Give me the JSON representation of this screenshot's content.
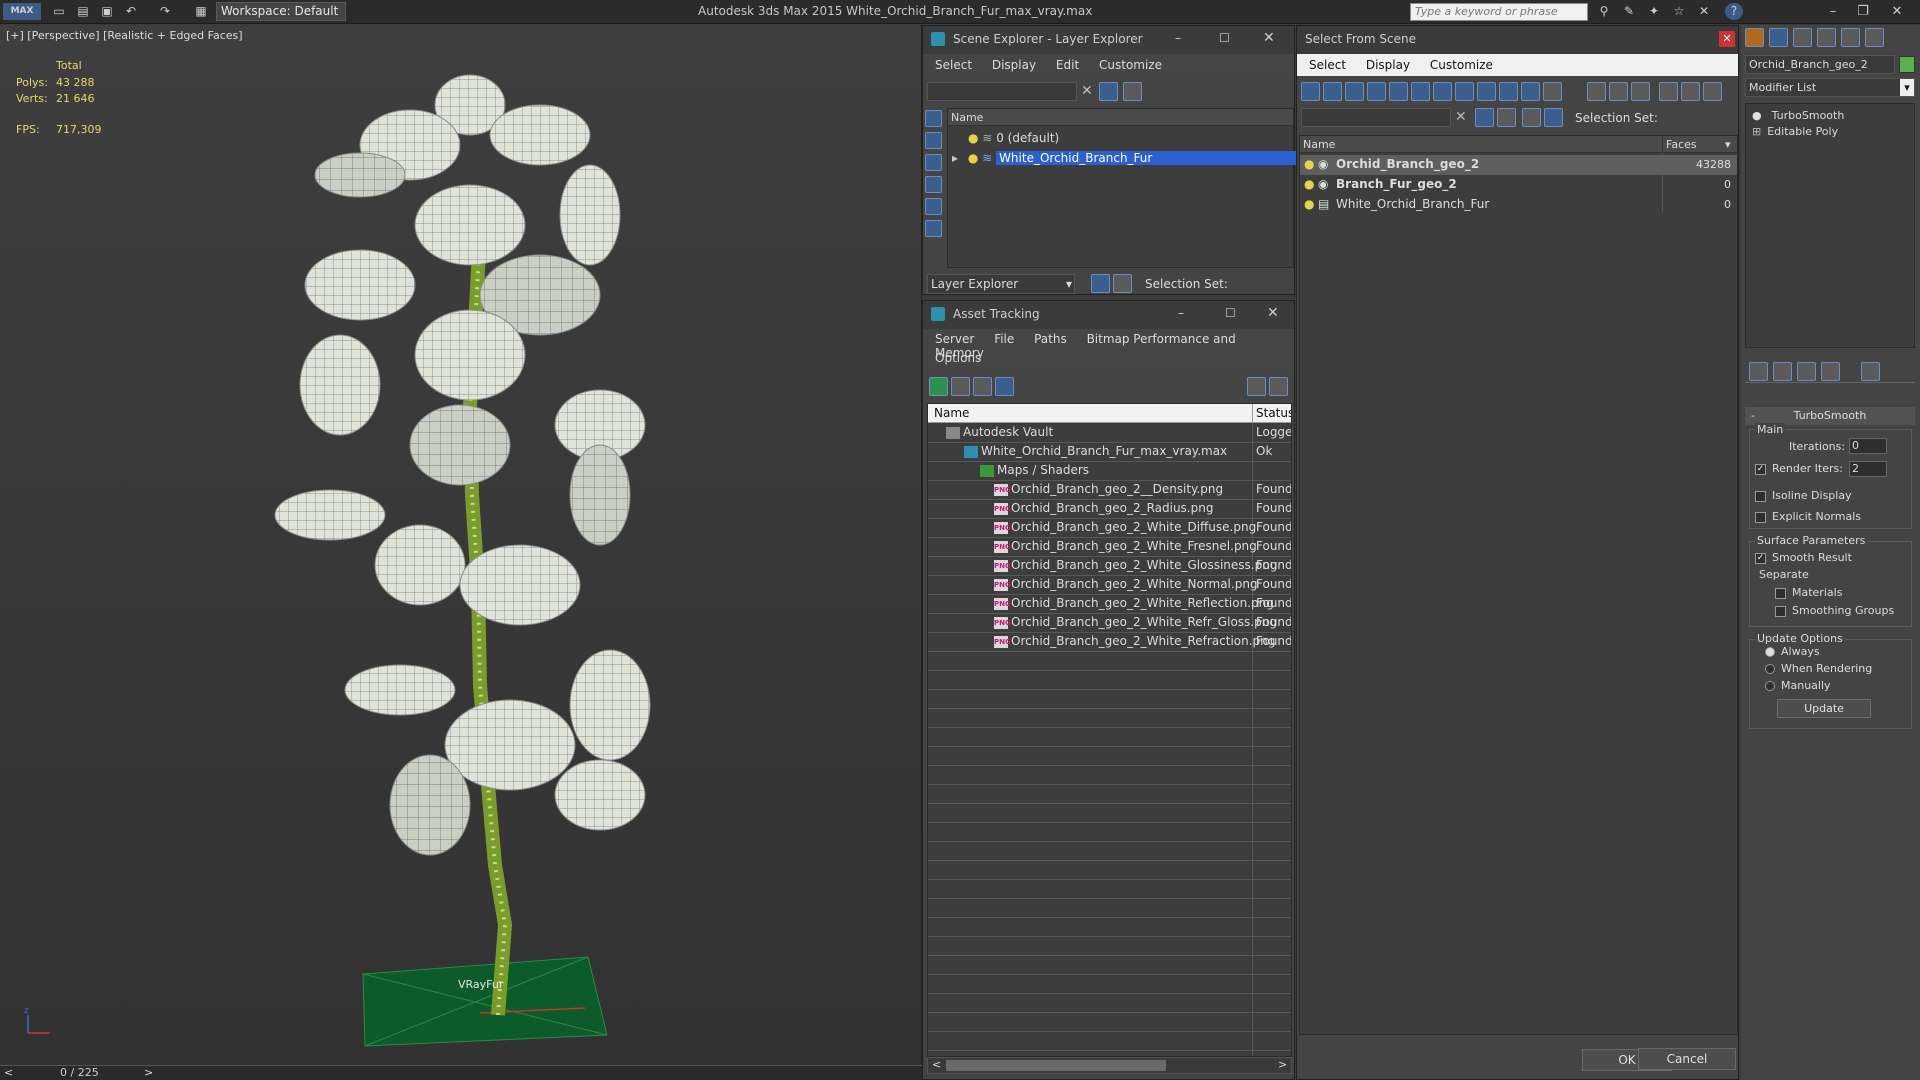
{
  "titlebar": {
    "app_menu": "MAX",
    "workspace": "Workspace: Default",
    "title": "Autodesk 3ds Max  2015    White_Orchid_Branch_Fur_max_vray.max",
    "search_placeholder": "Type a keyword or phrase"
  },
  "viewport": {
    "label": "[+] [Perspective] [Realistic + Edged Faces]",
    "stats_total": "Total",
    "polys_label": "Polys:",
    "polys": "43 288",
    "verts_label": "Verts:",
    "verts": "21 646",
    "fps_label": "FPS:",
    "fps": "717,309",
    "object_label": "VRayFur",
    "frame": "0 / 225"
  },
  "scene_explorer": {
    "title": "Scene Explorer - Layer Explorer",
    "menu": [
      "Select",
      "Display",
      "Edit",
      "Customize"
    ],
    "col_name": "Name",
    "layers": [
      "0 (default)",
      "White_Orchid_Branch_Fur"
    ],
    "footer_dropdown": "Layer Explorer",
    "selection_set": "Selection Set:"
  },
  "asset_tracking": {
    "title": "Asset Tracking",
    "menu1": [
      "Server",
      "File",
      "Paths",
      "Bitmap Performance and Memory"
    ],
    "menu2": [
      "Options"
    ],
    "col_name": "Name",
    "col_status": "Status",
    "rows": [
      {
        "name": "Autodesk Vault",
        "status": "Logged"
      },
      {
        "name": "White_Orchid_Branch_Fur_max_vray.max",
        "status": "Ok"
      },
      {
        "name": "Maps / Shaders",
        "status": ""
      },
      {
        "name": "Orchid_Branch_geo_2__Density.png",
        "status": "Found"
      },
      {
        "name": "Orchid_Branch_geo_2_Radius.png",
        "status": "Found"
      },
      {
        "name": "Orchid_Branch_geo_2_White_Diffuse.png",
        "status": "Found"
      },
      {
        "name": "Orchid_Branch_geo_2_White_Fresnel.png",
        "status": "Found"
      },
      {
        "name": "Orchid_Branch_geo_2_White_Glossiness.png",
        "status": "Found"
      },
      {
        "name": "Orchid_Branch_geo_2_White_Normal.png",
        "status": "Found"
      },
      {
        "name": "Orchid_Branch_geo_2_White_Reflection.png",
        "status": "Found"
      },
      {
        "name": "Orchid_Branch_geo_2_White_Refr_Gloss.png",
        "status": "Found"
      },
      {
        "name": "Orchid_Branch_geo_2_White_Refraction.png",
        "status": "Found"
      }
    ]
  },
  "select_from_scene": {
    "title": "Select From Scene",
    "menu": [
      "Select",
      "Display",
      "Customize"
    ],
    "selection_set": "Selection Set:",
    "col_name": "Name",
    "col_faces": "Faces",
    "rows": [
      {
        "name": "Orchid_Branch_geo_2",
        "faces": "43288"
      },
      {
        "name": "Branch_Fur_geo_2",
        "faces": "0"
      },
      {
        "name": "White_Orchid_Branch_Fur",
        "faces": "0"
      }
    ],
    "ok": "OK",
    "cancel": "Cancel"
  },
  "command_panel": {
    "object_name": "Orchid_Branch_geo_2",
    "modifier_list": "Modifier List",
    "stack": [
      "TurboSmooth",
      "Editable Poly"
    ],
    "rollout_title": "TurboSmooth",
    "main_group": "Main",
    "iterations_label": "Iterations:",
    "iterations": "0",
    "render_iters_label": "Render Iters:",
    "render_iters": "2",
    "isoline": "Isoline Display",
    "explicit_normals": "Explicit Normals",
    "surface_params": "Surface Parameters",
    "smooth_result": "Smooth Result",
    "separate": "Separate",
    "materials": "Materials",
    "smoothing_groups": "Smoothing Groups",
    "update_options": "Update Options",
    "always": "Always",
    "when_rendering": "When Rendering",
    "manually": "Manually",
    "update": "Update"
  }
}
